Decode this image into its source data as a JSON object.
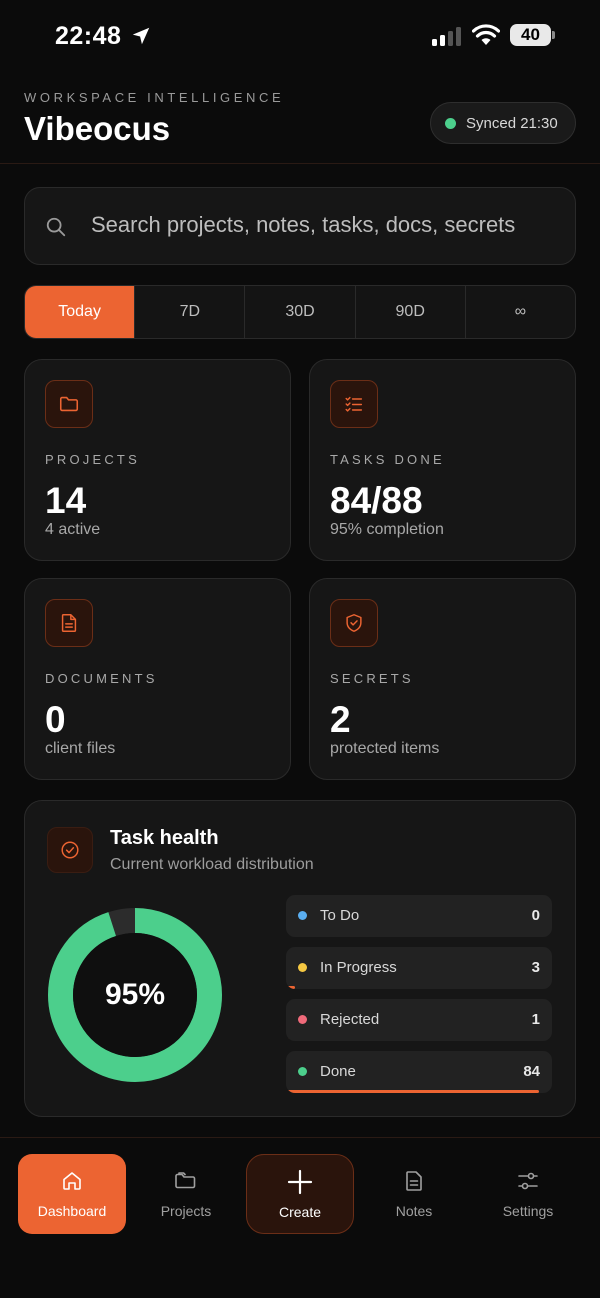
{
  "status_bar": {
    "time": "22:48",
    "battery": "40"
  },
  "header": {
    "eyebrow": "WORKSPACE INTELLIGENCE",
    "title": "Vibeocus",
    "sync_status": "Synced 21:30"
  },
  "search": {
    "placeholder": "Search projects, notes, tasks, docs, secrets"
  },
  "range_tabs": [
    "Today",
    "7D",
    "30D",
    "90D",
    "∞"
  ],
  "active_tab": "Today",
  "stats": [
    {
      "label": "PROJECTS",
      "value": "14",
      "sub": "4 active",
      "icon": "folder-icon"
    },
    {
      "label": "TASKS DONE",
      "value": "84/88",
      "sub": "95% completion",
      "icon": "checklist-icon"
    },
    {
      "label": "DOCUMENTS",
      "value": "0",
      "sub": "client files",
      "icon": "document-icon"
    },
    {
      "label": "SECRETS",
      "value": "2",
      "sub": "protected items",
      "icon": "shield-icon"
    }
  ],
  "task_health": {
    "title": "Task health",
    "subtitle": "Current workload distribution",
    "percent_label": "95%",
    "completion_fraction": 0.95,
    "statuses": [
      {
        "name": "To Do",
        "count": "0",
        "color": "#5aaef0",
        "fraction": 0
      },
      {
        "name": "In Progress",
        "count": "3",
        "color": "#f5c842",
        "fraction": 0.034
      },
      {
        "name": "Rejected",
        "count": "1",
        "color": "#f06a7a",
        "fraction": 0.011
      },
      {
        "name": "Done",
        "count": "84",
        "color": "#4ccf8c",
        "fraction": 0.95
      }
    ]
  },
  "nav": {
    "dashboard": "Dashboard",
    "projects": "Projects",
    "create": "Create",
    "notes": "Notes",
    "settings": "Settings"
  },
  "colors": {
    "accent": "#ec6432",
    "success": "#4ccf8c",
    "background": "#0b0b0b",
    "card": "#161616"
  }
}
